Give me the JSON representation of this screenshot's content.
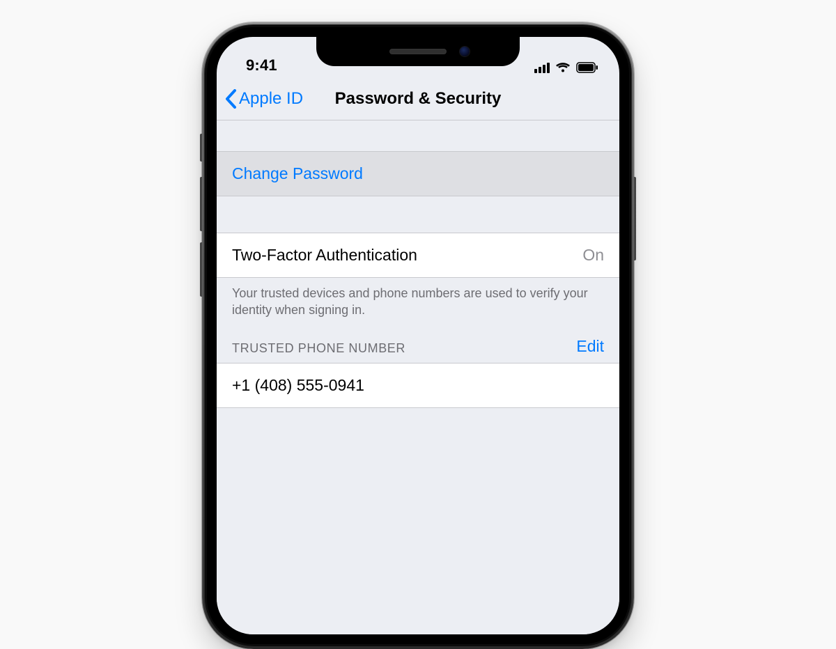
{
  "status": {
    "time": "9:41"
  },
  "nav": {
    "back_label": "Apple ID",
    "title": "Password & Security"
  },
  "change_password": {
    "label": "Change Password"
  },
  "two_factor": {
    "label": "Two-Factor Authentication",
    "value": "On"
  },
  "two_factor_footer": "Your trusted devices and phone numbers are used to verify your identity when signing in.",
  "trusted": {
    "header": "TRUSTED PHONE NUMBER",
    "edit": "Edit",
    "number": "+1 (408) 555-0941"
  }
}
